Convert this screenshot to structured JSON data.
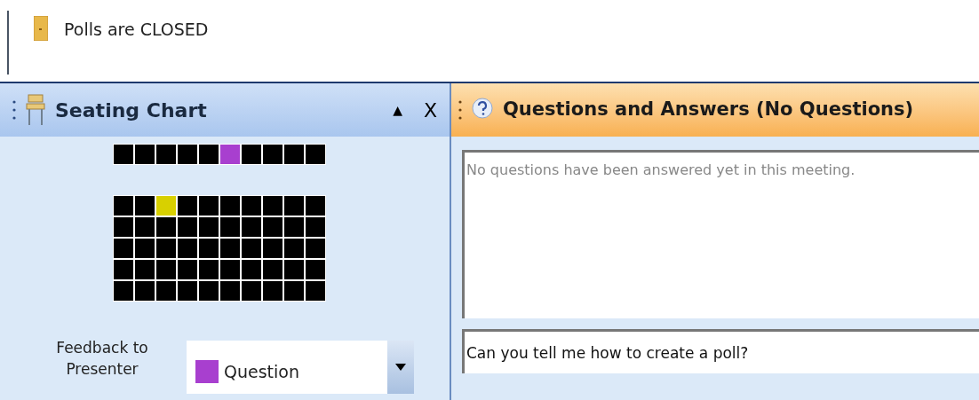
{
  "poll_status": {
    "text": "Polls are CLOSED"
  },
  "seating_panel": {
    "title": "Seating Chart",
    "collapse": "▲",
    "close": "X",
    "seat_rows": [
      {
        "seats": [
          {
            "color": "#000000"
          },
          {
            "color": "#000000"
          },
          {
            "color": "#000000"
          },
          {
            "color": "#000000"
          },
          {
            "color": "#000000"
          },
          {
            "color": "#a83fcf"
          },
          {
            "color": "#000000"
          },
          {
            "color": "#000000"
          },
          {
            "color": "#000000"
          },
          {
            "color": "#000000"
          }
        ]
      }
    ],
    "seat_grid": [
      {
        "seats": [
          {
            "color": "#000000"
          },
          {
            "color": "#000000"
          },
          {
            "color": "#d8d000"
          },
          {
            "color": "#000000"
          },
          {
            "color": "#000000"
          },
          {
            "color": "#000000"
          },
          {
            "color": "#000000"
          },
          {
            "color": "#000000"
          },
          {
            "color": "#000000"
          },
          {
            "color": "#000000"
          }
        ]
      },
      {
        "seats": [
          {
            "color": "#000000"
          },
          {
            "color": "#000000"
          },
          {
            "color": "#000000"
          },
          {
            "color": "#000000"
          },
          {
            "color": "#000000"
          },
          {
            "color": "#000000"
          },
          {
            "color": "#000000"
          },
          {
            "color": "#000000"
          },
          {
            "color": "#000000"
          },
          {
            "color": "#000000"
          }
        ]
      },
      {
        "seats": [
          {
            "color": "#000000"
          },
          {
            "color": "#000000"
          },
          {
            "color": "#000000"
          },
          {
            "color": "#000000"
          },
          {
            "color": "#000000"
          },
          {
            "color": "#000000"
          },
          {
            "color": "#000000"
          },
          {
            "color": "#000000"
          },
          {
            "color": "#000000"
          },
          {
            "color": "#000000"
          }
        ]
      },
      {
        "seats": [
          {
            "color": "#000000"
          },
          {
            "color": "#000000"
          },
          {
            "color": "#000000"
          },
          {
            "color": "#000000"
          },
          {
            "color": "#000000"
          },
          {
            "color": "#000000"
          },
          {
            "color": "#000000"
          },
          {
            "color": "#000000"
          },
          {
            "color": "#000000"
          },
          {
            "color": "#000000"
          }
        ]
      },
      {
        "seats": [
          {
            "color": "#000000"
          },
          {
            "color": "#000000"
          },
          {
            "color": "#000000"
          },
          {
            "color": "#000000"
          },
          {
            "color": "#000000"
          },
          {
            "color": "#000000"
          },
          {
            "color": "#000000"
          },
          {
            "color": "#000000"
          },
          {
            "color": "#000000"
          },
          {
            "color": "#000000"
          }
        ]
      }
    ],
    "feedback": {
      "label": "Feedback to Presenter",
      "value": "Question",
      "color": "#a83fcf"
    }
  },
  "qa_panel": {
    "title": "Questions and Answers (No Questions)",
    "placeholder": "No questions have been answered yet in this meeting.",
    "question_input": {
      "value": "Can you tell me how to create a poll?"
    }
  }
}
